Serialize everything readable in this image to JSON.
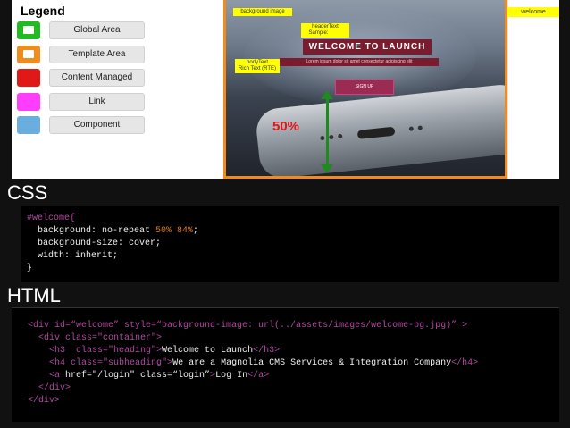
{
  "legend": {
    "title": "Legend",
    "items": [
      {
        "label": "Global Area",
        "color": "#22bb22"
      },
      {
        "label": "Template Area",
        "color": "#f08c1e"
      },
      {
        "label": "Content Managed",
        "color": "#e01818"
      },
      {
        "label": "Link",
        "color": "#ff3dff"
      },
      {
        "label": "Component",
        "color": "#6aaee0"
      }
    ]
  },
  "mockup": {
    "bg_tag": "background image",
    "heading_tag": [
      "headerText",
      "Sample:         "
    ],
    "body_tag": [
      "bodyText",
      "Rich Text (RTE)"
    ],
    "headline": "WELCOME TO LAUNCH",
    "subheadline": "Lorem ipsum dolor sit amet consectetur adipiscing elit",
    "button": "SIGN UP",
    "percent": "50%"
  },
  "right_tag": "welcome",
  "css_section": {
    "title": "CSS",
    "lines": [
      {
        "parts": [
          [
            "#welcome{",
            "purple"
          ]
        ]
      },
      {
        "parts": [
          [
            "  background: no-repeat ",
            "white"
          ],
          [
            "50% 84%",
            "orange"
          ],
          [
            ";",
            "white"
          ]
        ]
      },
      {
        "parts": [
          [
            "  background-size: cover;",
            "white"
          ]
        ]
      },
      {
        "parts": [
          [
            "  width: inherit;",
            "white"
          ]
        ]
      },
      {
        "parts": [
          [
            "}",
            "white"
          ]
        ]
      }
    ]
  },
  "html_section": {
    "title": "HTML",
    "lines": [
      {
        "parts": [
          [
            "<div ",
            "purple"
          ],
          [
            "id=“welcome” style=“background-image: url(../assets/images/welcome-bg.jpg)” ",
            "purple"
          ],
          [
            ">",
            "purple"
          ]
        ]
      },
      {
        "parts": [
          [
            "  <div ",
            "purple"
          ],
          [
            "class=\"container\"",
            "purple"
          ],
          [
            ">",
            "purple"
          ]
        ]
      },
      {
        "parts": [
          [
            "    <h3  ",
            "purple"
          ],
          [
            "class=\"heading\"",
            "purple"
          ],
          [
            ">",
            "purple"
          ],
          [
            "Welcome to Launch",
            "white"
          ],
          [
            "</h3>",
            "purple"
          ]
        ]
      },
      {
        "parts": [
          [
            "    <h4 ",
            "purple"
          ],
          [
            "class=\"subheading\"",
            "purple"
          ],
          [
            ">",
            "purple"
          ],
          [
            "We are a Magnolia CMS Services & Integration Company",
            "white"
          ],
          [
            "</h4>",
            "purple"
          ]
        ]
      },
      {
        "parts": [
          [
            "    <a ",
            "purple"
          ],
          [
            "href=\"/login\" class=“login”",
            "white"
          ],
          [
            ">",
            "purple"
          ],
          [
            "Log In",
            "white"
          ],
          [
            "</a>",
            "purple"
          ]
        ]
      },
      {
        "parts": [
          [
            "  </div>",
            "purple"
          ]
        ]
      },
      {
        "parts": [
          [
            "</div>",
            "purple"
          ]
        ]
      }
    ]
  }
}
